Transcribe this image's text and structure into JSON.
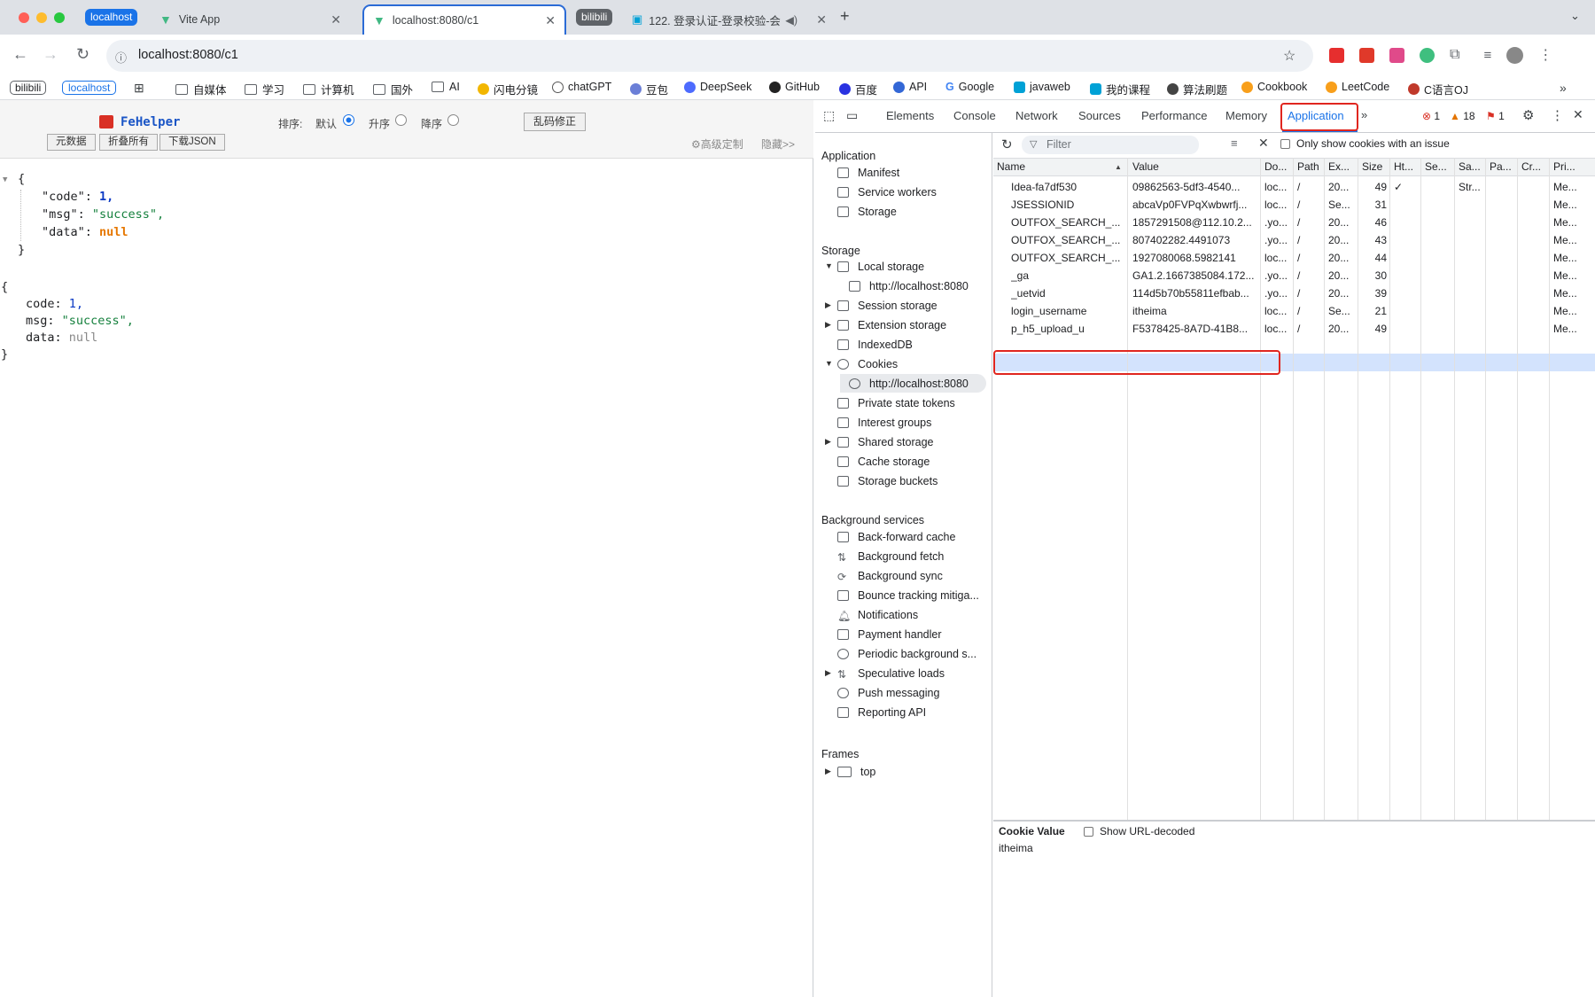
{
  "tabs": {
    "group1": "localhost",
    "tab1": "Vite App",
    "tab2": "localhost:8080/c1",
    "group2": "bilibili",
    "tab3": "122. 登录认证-登录校验-会"
  },
  "address": "localhost:8080/c1",
  "bookmarks": [
    "bilibili",
    "localhost",
    "自媒体",
    "学习",
    "计算机",
    "国外",
    "AI",
    "闪电分镜",
    "chatGPT",
    "豆包",
    "DeepSeek",
    "GitHub",
    "百度",
    "API",
    "Google",
    "javaweb",
    "我的课程",
    "算法刷题",
    "Cookbook",
    "LeetCode",
    "C语言OJ"
  ],
  "fehelper": {
    "title": "FeHelper",
    "sort_label": "排序:",
    "opt_default": "默认",
    "opt_asc": "升序",
    "opt_desc": "降序",
    "fix_btn": "乱码修正",
    "btn_raw": "元数据",
    "btn_fold": "折叠所有",
    "btn_download": "下载JSON",
    "advanced": "⚙高级定制",
    "hide": "隐藏>>"
  },
  "json1": {
    "l1": "{",
    "k_code": "\"code\": ",
    "v_code": "1,",
    "k_msg": "\"msg\": ",
    "v_msg": "\"success\",",
    "k_data": "\"data\": ",
    "v_data": "null",
    "l5": "}"
  },
  "json2": {
    "l1": "{",
    "k_code": "code: ",
    "v_code": "1,",
    "k_msg": "msg: ",
    "v_msg": "\"success\",",
    "k_data": "data: ",
    "v_data": "null",
    "l5": "}"
  },
  "devtools": {
    "tabs": [
      "Elements",
      "Console",
      "Network",
      "Sources",
      "Performance",
      "Memory",
      "Application"
    ],
    "errors": "1",
    "warnings": "18",
    "issues": "1"
  },
  "sidebar": {
    "h_app": "Application",
    "manifest": "Manifest",
    "sw": "Service workers",
    "storage": "Storage",
    "h_storage": "Storage",
    "local": "Local storage",
    "local_origin": "http://localhost:8080",
    "session": "Session storage",
    "extension": "Extension storage",
    "indexeddb": "IndexedDB",
    "cookies": "Cookies",
    "cookie_origin": "http://localhost:8080",
    "pst": "Private state tokens",
    "interest": "Interest groups",
    "shared": "Shared storage",
    "cache": "Cache storage",
    "buckets": "Storage buckets",
    "h_bg": "Background services",
    "bfcache": "Back-forward cache",
    "bgfetch": "Background fetch",
    "bgsync": "Background sync",
    "bounce": "Bounce tracking mitiga...",
    "notif": "Notifications",
    "payment": "Payment handler",
    "periodic": "Periodic background s...",
    "spec": "Speculative loads",
    "push": "Push messaging",
    "reporting": "Reporting API",
    "h_frames": "Frames",
    "top": "top"
  },
  "filter": {
    "placeholder": "Filter",
    "only_issue": "Only show cookies with an issue"
  },
  "columns": [
    "Name",
    "Value",
    "Do...",
    "Path",
    "Ex...",
    "Size",
    "Ht...",
    "Se...",
    "Sa...",
    "Pa...",
    "Cr...",
    "Pri..."
  ],
  "rows": [
    [
      "Idea-fa7df530",
      "09862563-5df3-4540...",
      "loc...",
      "/",
      "20...",
      "49",
      "✓",
      "",
      "Str...",
      "",
      "",
      "Me..."
    ],
    [
      "JSESSIONID",
      "abcaVp0FVPqXwbwrfj...",
      "loc...",
      "/",
      "Se...",
      "31",
      "",
      "",
      "",
      "",
      "",
      "Me..."
    ],
    [
      "OUTFOX_SEARCH_...",
      "1857291508@112.10.2...",
      ".yo...",
      "/",
      "20...",
      "46",
      "",
      "",
      "",
      "",
      "",
      "Me..."
    ],
    [
      "OUTFOX_SEARCH_...",
      "807402282.4491073",
      ".yo...",
      "/",
      "20...",
      "43",
      "",
      "",
      "",
      "",
      "",
      "Me..."
    ],
    [
      "OUTFOX_SEARCH_...",
      "1927080068.5982141",
      "loc...",
      "/",
      "20...",
      "44",
      "",
      "",
      "",
      "",
      "",
      "Me..."
    ],
    [
      "_ga",
      "GA1.2.1667385084.172...",
      ".yo...",
      "/",
      "20...",
      "30",
      "",
      "",
      "",
      "",
      "",
      "Me..."
    ],
    [
      "_uetvid",
      "114d5b70b55811efbab...",
      ".yo...",
      "/",
      "20...",
      "39",
      "",
      "",
      "",
      "",
      "",
      "Me..."
    ],
    [
      "login_username",
      "itheima",
      "loc...",
      "/",
      "Se...",
      "21",
      "",
      "",
      "",
      "",
      "",
      "Me..."
    ],
    [
      "p_h5_upload_u",
      "F5378425-8A7D-41B8...",
      "loc...",
      "/",
      "20...",
      "49",
      "",
      "",
      "",
      "",
      "",
      "Me..."
    ]
  ],
  "cookie_value": {
    "title": "Cookie Value",
    "decode_label": "Show URL-decoded",
    "value": "itheima"
  }
}
